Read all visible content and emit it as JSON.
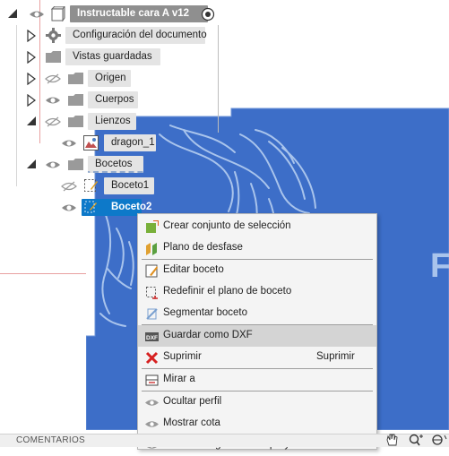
{
  "browser": {
    "root_label": "Instructable cara A v12",
    "items": [
      {
        "label": "Configuración del documento"
      },
      {
        "label": "Vistas guardadas"
      },
      {
        "label": "Origen"
      },
      {
        "label": "Cuerpos"
      },
      {
        "label": "Lienzos"
      },
      {
        "label": "dragon_1"
      },
      {
        "label": "Bocetos"
      },
      {
        "label": "Boceto1"
      },
      {
        "label": "Boceto2"
      }
    ]
  },
  "canvas": {
    "partial_text": "F",
    "sketch_fill_color": "#3d6ec8",
    "sketch_line_color": "#a9c4ec"
  },
  "context_menu": {
    "items": [
      {
        "label": "Crear conjunto de selección",
        "icon": "selection-set-icon"
      },
      {
        "label": "Plano de desfase",
        "icon": "offset-plane-icon"
      },
      {
        "label": "Editar boceto",
        "icon": "edit-sketch-icon"
      },
      {
        "label": "Redefinir el plano de boceto",
        "icon": "redefine-plane-icon"
      },
      {
        "label": "Segmentar boceto",
        "icon": "slice-sketch-icon"
      },
      {
        "label": "Guardar como DXF",
        "icon": "dxf-icon"
      },
      {
        "label": "Suprimir",
        "shortcut": "Suprimir",
        "icon": "delete-icon"
      },
      {
        "label": "Mirar a",
        "icon": "look-at-icon"
      },
      {
        "label": "Ocultar perfil",
        "icon": "eye-icon"
      },
      {
        "label": "Mostrar cota",
        "icon": "eye-icon"
      },
      {
        "label": "Ocultar las geometrías proyectadas",
        "icon": "eye-icon"
      }
    ]
  },
  "bottom_bar": {
    "label": "COMENTARIOS"
  },
  "colors": {
    "selection": "#0d79c9",
    "menu_highlight": "#d4d4d4",
    "root_node": "#8f8f8f"
  }
}
